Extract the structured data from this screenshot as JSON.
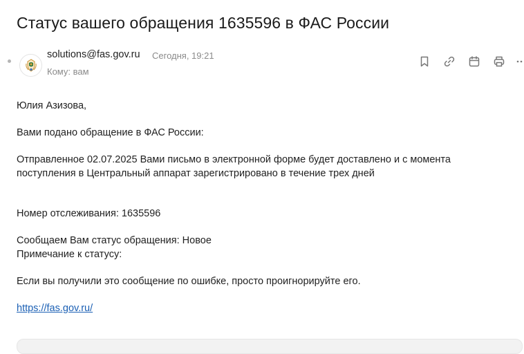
{
  "message": {
    "subject": "Статус вашего обращения 1635596 в ФАС России",
    "sender_email": "solutions@fas.gov.ru",
    "date": "Сегодня, 19:21",
    "recipient_line": "Кому: вам"
  },
  "toolbar": {
    "icons": [
      "bookmark-icon",
      "link-icon",
      "calendar-icon",
      "print-icon",
      "more-icon"
    ]
  },
  "body": {
    "greeting": "Юлия Азизова,",
    "line_intro": "Вами подано обращение в ФАС России:",
    "line_sent_1": "Отправленное 02.07.2025 Вами письмо в электронной форме будет доставлено и с момента",
    "line_sent_2": "поступления в Центральный аппарат зарегистрировано в течение трех дней",
    "tracking": "Номер отслеживания: 1635596",
    "status": "Сообщаем Вам статус обращения: Новое",
    "status_note": "Примечание к статусу:",
    "error_note": "Если вы получили это сообщение по ошибке, просто проигнорируйте его.",
    "link": "https://fas.gov.ru/"
  },
  "colors": {
    "link": "#1a5fb4",
    "meta": "#8a8a8a",
    "icon": "#777777"
  }
}
